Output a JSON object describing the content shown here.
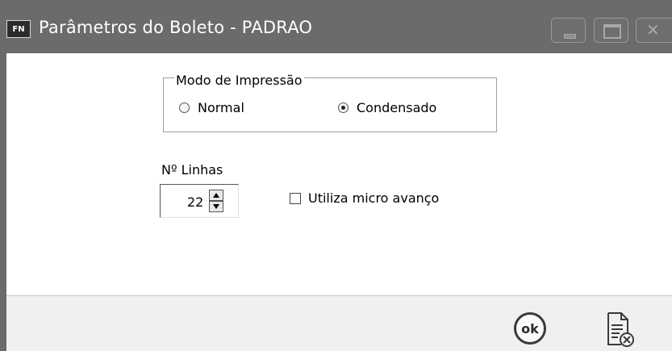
{
  "window": {
    "icon_text": "FN",
    "title": "Parâmetros do Boleto - PADRAO"
  },
  "print_mode": {
    "legend": "Modo de Impressão",
    "options": [
      {
        "label": "Normal",
        "checked": false
      },
      {
        "label": "Condensado",
        "checked": true
      }
    ]
  },
  "lines": {
    "label": "Nº Linhas",
    "value": "22"
  },
  "micro_advance": {
    "label": "Utiliza micro avanço",
    "checked": false
  },
  "footer": {
    "ok_label": "ok"
  }
}
